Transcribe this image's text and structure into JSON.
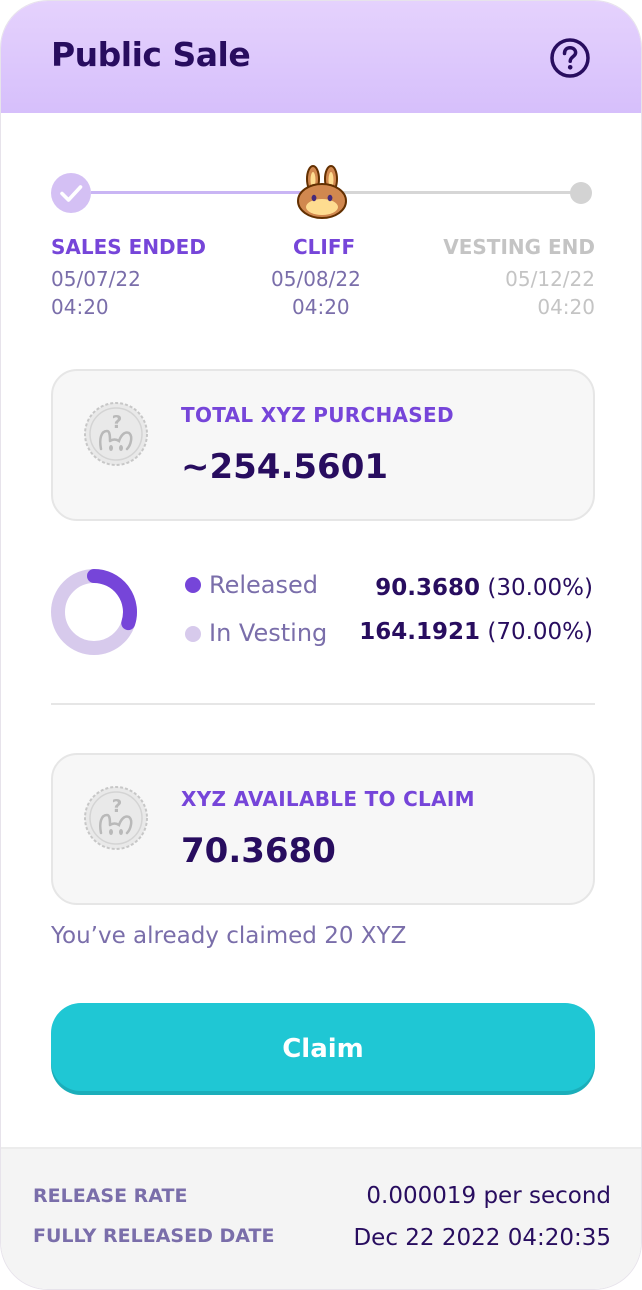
{
  "header": {
    "title": "Public Sale",
    "help_icon": "question-circle-icon"
  },
  "stepper": {
    "steps": [
      {
        "label": "SALES ENDED",
        "date": "05/07/22",
        "time": "04:20",
        "state": "done",
        "icon": "check-icon"
      },
      {
        "label": "CLIFF",
        "date": "05/08/22",
        "time": "04:20",
        "state": "current",
        "icon": "bunny-icon"
      },
      {
        "label": "VESTING END",
        "date": "05/12/22",
        "time": "04:20",
        "state": "upcoming",
        "icon": "dot-icon"
      }
    ]
  },
  "purchased": {
    "label": "TOTAL XYZ PURCHASED",
    "value": "~254.5601",
    "icon": "unknown-token-icon"
  },
  "distribution": {
    "released_fraction": 0.3,
    "items": [
      {
        "label": "Released",
        "amount": "90.3680",
        "percent": "(30.00%)",
        "color": "#7645d9"
      },
      {
        "label": "In Vesting",
        "amount": "164.1921",
        "percent": "(70.00%)",
        "color": "#d7caec"
      }
    ]
  },
  "claimable": {
    "label": "XYZ AVAILABLE TO CLAIM",
    "value": "70.3680",
    "icon": "unknown-token-icon"
  },
  "claimed_note": "You’ve already claimed 20 XYZ",
  "claim_button": {
    "label": "Claim"
  },
  "footer": {
    "release_rate_label": "RELEASE RATE",
    "release_rate_value": "0.000019 per second",
    "fully_released_label": "FULLY RELEASED DATE",
    "fully_released_value": "Dec 22 2022 04:20:35"
  },
  "colors": {
    "primary": "#7645d9",
    "text": "#280d5f",
    "subtle": "#7a6eaa",
    "accent": "#1fc7d4",
    "disabled": "#bdc2c4"
  }
}
